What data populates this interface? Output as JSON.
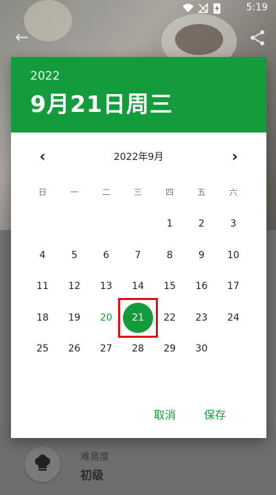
{
  "status_bar": {
    "time": "5:19",
    "icons": [
      "wifi-icon",
      "signal-icon",
      "battery-charging-icon"
    ]
  },
  "background": {
    "back_icon": "arrow-left-icon",
    "share_icon": "share-icon",
    "difficulty_label": "难易度",
    "difficulty_value": "初级",
    "chef_icon": "chef-hat-icon"
  },
  "dialog": {
    "year": "2022",
    "selected_date_text": "9月21日周三",
    "month_title": "2022年9月",
    "prev_icon": "chevron-left-icon",
    "next_icon": "chevron-right-icon",
    "weekdays": [
      "日",
      "一",
      "二",
      "三",
      "四",
      "五",
      "六"
    ],
    "weeks": [
      [
        "",
        "",
        "",
        "",
        "1",
        "2",
        "3"
      ],
      [
        "4",
        "5",
        "6",
        "7",
        "8",
        "9",
        "10"
      ],
      [
        "11",
        "12",
        "13",
        "14",
        "15",
        "16",
        "17"
      ],
      [
        "18",
        "19",
        "20",
        "21",
        "22",
        "23",
        "24"
      ],
      [
        "25",
        "26",
        "27",
        "28",
        "29",
        "30",
        ""
      ]
    ],
    "today_day": "20",
    "selected_day": "21",
    "cancel_label": "取消",
    "ok_label": "保存",
    "accent_color": "#149b3c",
    "highlight_box_color": "#e0101a"
  }
}
